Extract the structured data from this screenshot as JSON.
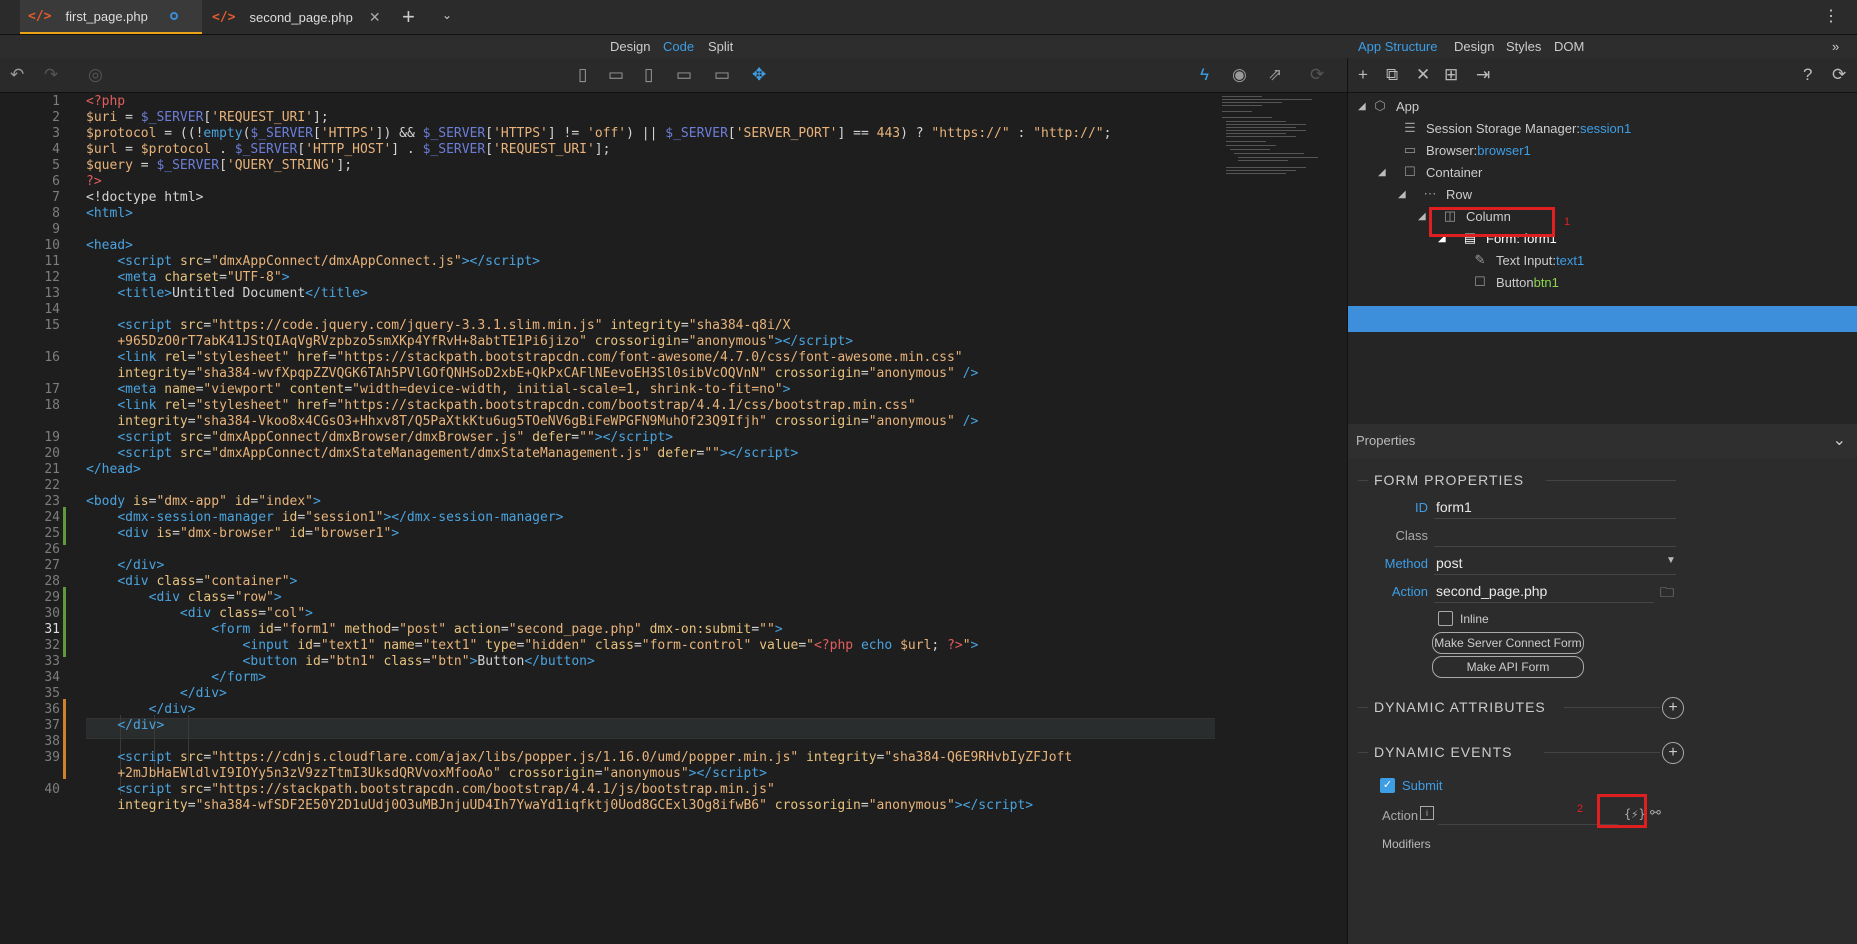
{
  "tabs": [
    {
      "label": "first_page.php",
      "active": true
    },
    {
      "label": "second_page.php",
      "active": false
    }
  ],
  "view_modes": {
    "design": "Design",
    "code": "Code",
    "split": "Split"
  },
  "right_tabs": {
    "app_structure": "App Structure",
    "design": "Design",
    "styles": "Styles",
    "dom": "DOM"
  },
  "code_lines": [
    {
      "n": "1",
      "html": "<span class='kw'>&lt;?php</span>"
    },
    {
      "n": "2",
      "html": "<span class='var'>$uri</span> = <span class='sv'>$_SERVER</span>[<span class='str'>'REQUEST_URI'</span>];"
    },
    {
      "n": "3",
      "html": "<span class='var'>$protocol</span> = ((!<span class='fn'>empty</span>(<span class='sv'>$_SERVER</span>[<span class='str'>'HTTPS'</span>]) &amp;&amp; <span class='sv'>$_SERVER</span>[<span class='str'>'HTTPS'</span>] != <span class='str'>'off'</span>) || <span class='sv'>$_SERVER</span>[<span class='str'>'SERVER_PORT'</span>] == <span class='str'>443</span>) ? <span class='str'>\"https://\"</span> : <span class='str'>\"http://\"</span>;"
    },
    {
      "n": "4",
      "html": "<span class='var'>$url</span> = <span class='var'>$protocol</span> . <span class='sv'>$_SERVER</span>[<span class='str'>'HTTP_HOST'</span>] . <span class='sv'>$_SERVER</span>[<span class='str'>'REQUEST_URI'</span>];"
    },
    {
      "n": "5",
      "html": "<span class='var'>$query</span> = <span class='sv'>$_SERVER</span>[<span class='str'>'QUERY_STRING'</span>];"
    },
    {
      "n": "6",
      "html": "<span class='kw'>?&gt;</span>"
    },
    {
      "n": "7",
      "html": "<span class='txt'>&lt;!doctype html&gt;</span>"
    },
    {
      "n": "8",
      "html": "<span class='tag'>&lt;html&gt;</span>"
    },
    {
      "n": "9",
      "html": ""
    },
    {
      "n": "10",
      "html": "<span class='tag'>&lt;head&gt;</span>"
    },
    {
      "n": "11",
      "html": "    <span class='tag'>&lt;script</span> <span class='attr'>src</span>=<span class='av'>\"dmxAppConnect/dmxAppConnect.js\"</span><span class='tag'>&gt;&lt;/script&gt;</span>"
    },
    {
      "n": "12",
      "html": "    <span class='tag'>&lt;meta</span> <span class='attr'>charset</span>=<span class='av'>\"UTF-8\"</span><span class='tag'>&gt;</span>"
    },
    {
      "n": "13",
      "html": "    <span class='tag'>&lt;title&gt;</span>Untitled Document<span class='tag'>&lt;/title&gt;</span>"
    },
    {
      "n": "14",
      "html": ""
    },
    {
      "n": "15",
      "html": "    <span class='tag'>&lt;script</span> <span class='attr'>src</span>=<span class='av'>\"https://code.jquery.com/jquery-3.3.1.slim.min.js\"</span> <span class='attr'>integrity</span>=<span class='av'>\"sha384-q8i/X</span>"
    },
    {
      "n": "",
      "html": "    <span class='av'>+965DzO0rT7abK41JStQIAqVgRVzpbzo5smXKp4YfRvH+8abtTE1Pi6jizo\"</span> <span class='attr'>crossorigin</span>=<span class='av'>\"anonymous\"</span><span class='tag'>&gt;&lt;/script&gt;</span>"
    },
    {
      "n": "16",
      "html": "    <span class='tag'>&lt;link</span> <span class='attr'>rel</span>=<span class='av'>\"stylesheet\"</span> <span class='attr'>href</span>=<span class='av'>\"https://stackpath.bootstrapcdn.com/font-awesome/4.7.0/css/font-awesome.min.css\"</span>"
    },
    {
      "n": "",
      "html": "    <span class='attr'>integrity</span>=<span class='av'>\"sha384-wvfXpqpZZVQGK6TAh5PVlGOfQNHSoD2xbE+QkPxCAFlNEevoEH3Sl0sibVcOQVnN\"</span> <span class='attr'>crossorigin</span>=<span class='av'>\"anonymous\"</span> <span class='tag'>/&gt;</span>"
    },
    {
      "n": "17",
      "html": "    <span class='tag'>&lt;meta</span> <span class='attr'>name</span>=<span class='av'>\"viewport\"</span> <span class='attr'>content</span>=<span class='av'>\"width=device-width, initial-scale=1, shrink-to-fit=no\"</span><span class='tag'>&gt;</span>"
    },
    {
      "n": "18",
      "html": "    <span class='tag'>&lt;link</span> <span class='attr'>rel</span>=<span class='av'>\"stylesheet\"</span> <span class='attr'>href</span>=<span class='av'>\"https://stackpath.bootstrapcdn.com/bootstrap/4.4.1/css/bootstrap.min.css\"</span>"
    },
    {
      "n": "",
      "html": "    <span class='attr'>integrity</span>=<span class='av'>\"sha384-Vkoo8x4CGsO3+Hhxv8T/Q5PaXtkKtu6ug5TOeNV6gBiFeWPGFN9MuhOf23Q9Ifjh\"</span> <span class='attr'>crossorigin</span>=<span class='av'>\"anonymous\"</span> <span class='tag'>/&gt;</span>"
    },
    {
      "n": "19",
      "html": "    <span class='tag'>&lt;script</span> <span class='attr'>src</span>=<span class='av'>\"dmxAppConnect/dmxBrowser/dmxBrowser.js\"</span> <span class='attr'>defer</span>=<span class='av'>\"\"</span><span class='tag'>&gt;&lt;/script&gt;</span>"
    },
    {
      "n": "20",
      "html": "    <span class='tag'>&lt;script</span> <span class='attr'>src</span>=<span class='av'>\"dmxAppConnect/dmxStateManagement/dmxStateManagement.js\"</span> <span class='attr'>defer</span>=<span class='av'>\"\"</span><span class='tag'>&gt;&lt;/script&gt;</span>"
    },
    {
      "n": "21",
      "html": "<span class='tag'>&lt;/head&gt;</span>"
    },
    {
      "n": "22",
      "html": ""
    },
    {
      "n": "23",
      "html": "<span class='tag'>&lt;body</span> <span class='attr'>is</span>=<span class='av'>\"dmx-app\"</span> <span class='attr'>id</span>=<span class='av'>\"index\"</span><span class='tag'>&gt;</span>"
    },
    {
      "n": "24",
      "html": "    <span class='tag'>&lt;dmx-session-manager</span> <span class='attr'>id</span>=<span class='av'>\"session1\"</span><span class='tag'>&gt;&lt;/dmx-session-manager&gt;</span>"
    },
    {
      "n": "25",
      "html": "    <span class='tag'>&lt;div</span> <span class='attr'>is</span>=<span class='av'>\"dmx-browser\"</span> <span class='attr'>id</span>=<span class='av'>\"browser1\"</span><span class='tag'>&gt;</span>"
    },
    {
      "n": "26",
      "html": ""
    },
    {
      "n": "27",
      "html": "    <span class='tag'>&lt;/div&gt;</span>"
    },
    {
      "n": "28",
      "html": "    <span class='tag'>&lt;div</span> <span class='attr'>class</span>=<span class='av'>\"container\"</span><span class='tag'>&gt;</span>"
    },
    {
      "n": "29",
      "html": "        <span class='tag'>&lt;div</span> <span class='attr'>class</span>=<span class='av'>\"row\"</span><span class='tag'>&gt;</span>"
    },
    {
      "n": "30",
      "html": "            <span class='tag'>&lt;div</span> <span class='attr'>class</span>=<span class='av'>\"col\"</span><span class='tag'>&gt;</span>"
    },
    {
      "n": "31",
      "html": "                <span class='tag'>&lt;form</span> <span class='attr'>id</span>=<span class='av'>\"form1\"</span> <span class='attr'>method</span>=<span class='av'>\"post\"</span> <span class='attr'>action</span>=<span class='av'>\"second_page.php\"</span> <span class='attr'>dmx-on:submit</span>=<span class='av'>\"\"</span><span class='tag'>&gt;</span>"
    },
    {
      "n": "32",
      "html": "                    <span class='tag'>&lt;input</span> <span class='attr'>id</span>=<span class='av'>\"text1\"</span> <span class='attr'>name</span>=<span class='av'>\"text1\"</span> <span class='attr'>type</span>=<span class='av'>\"hidden\"</span> <span class='attr'>class</span>=<span class='av'>\"form-control\"</span> <span class='attr'>value</span>=<span class='av'>\"</span><span class='kw'>&lt;?php</span> <span class='fn'>echo</span> <span class='var'>$url</span>; <span class='kw'>?&gt;</span><span class='av'>\"</span><span class='tag'>&gt;</span>"
    },
    {
      "n": "33",
      "html": "                    <span class='tag'>&lt;button</span> <span class='attr'>id</span>=<span class='av'>\"btn1\"</span> <span class='attr'>class</span>=<span class='av'>\"btn\"</span><span class='tag'>&gt;</span>Button<span class='tag'>&lt;/button&gt;</span>"
    },
    {
      "n": "34",
      "html": "                <span class='tag'>&lt;/form&gt;</span>"
    },
    {
      "n": "35",
      "html": "            <span class='tag'>&lt;/div&gt;</span>"
    },
    {
      "n": "36",
      "html": "        <span class='tag'>&lt;/div&gt;</span>"
    },
    {
      "n": "37",
      "html": "    <span class='tag'>&lt;/div&gt;</span>"
    },
    {
      "n": "38",
      "html": ""
    },
    {
      "n": "39",
      "html": "    <span class='tag'>&lt;script</span> <span class='attr'>src</span>=<span class='av'>\"https://cdnjs.cloudflare.com/ajax/libs/popper.js/1.16.0/umd/popper.min.js\"</span> <span class='attr'>integrity</span>=<span class='av'>\"sha384-Q6E9RHvbIyZFJoft</span>"
    },
    {
      "n": "",
      "html": "    <span class='av'>+2mJbHaEWldlvI9IOYy5n3zV9zzTtmI3UksdQRVvoxMfooAo\"</span> <span class='attr'>crossorigin</span>=<span class='av'>\"anonymous\"</span><span class='tag'>&gt;&lt;/script&gt;</span>"
    },
    {
      "n": "40",
      "html": "    <span class='tag'>&lt;script</span> <span class='attr'>src</span>=<span class='av'>\"https://stackpath.bootstrapcdn.com/bootstrap/4.4.1/js/bootstrap.min.js\"</span>"
    },
    {
      "n": "",
      "html": "    <span class='attr'>integrity</span>=<span class='av'>\"sha384-wfSDF2E50Y2D1uUdj0O3uMBJnjuUD4Ih7YwaYd1iqfktj0Uod8GCExl3Og8ifwB6\"</span> <span class='attr'>crossorigin</span>=<span class='av'>\"anonymous\"</span><span class='tag'>&gt;&lt;/script&gt;</span>"
    }
  ],
  "tree": {
    "app": "App",
    "session_label": "Session Storage Manager: ",
    "session_val": "session1",
    "browser_label": "Browser: ",
    "browser_val": "browser1",
    "container": "Container",
    "row": "Row",
    "column": "Column",
    "form_label": "Form: form1",
    "text_input_label": "Text Input: ",
    "text_input_val": "text1",
    "button_label": "Button ",
    "button_val": "btn1"
  },
  "annotations": {
    "one": "1",
    "two": "2"
  },
  "properties": {
    "bar_label": "Properties",
    "form_properties": "FORM PROPERTIES",
    "id_label": "ID",
    "id_value": "form1",
    "class_label": "Class",
    "method_label": "Method",
    "method_value": "post",
    "action_label": "Action",
    "action_value": "second_page.php",
    "inline_label": "Inline",
    "server_connect_btn": "Make Server Connect Form",
    "api_btn": "Make API Form",
    "dynamic_attributes": "DYNAMIC ATTRIBUTES",
    "dynamic_events": "DYNAMIC EVENTS",
    "submit_label": "Submit",
    "event_action_label": "Action",
    "modifiers_label": "Modifiers"
  }
}
